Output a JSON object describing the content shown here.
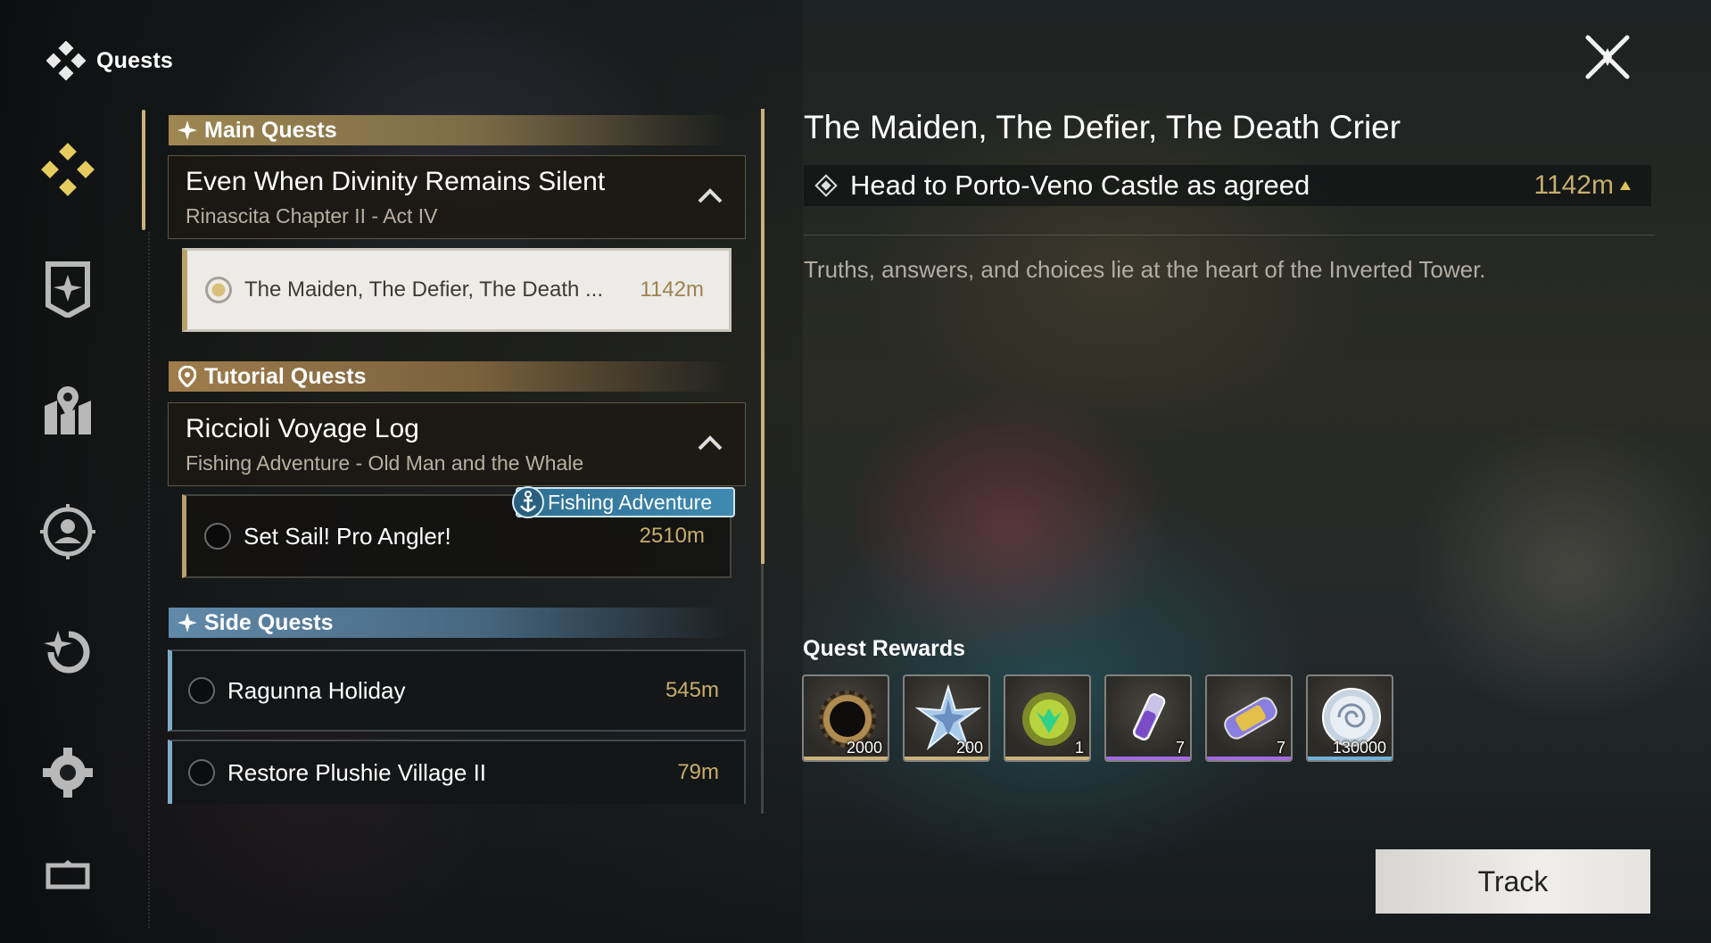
{
  "header": {
    "title": "Quests"
  },
  "nav": {
    "items": [
      {
        "name": "quests",
        "icon": "quest-diamond-icon",
        "active": true
      },
      {
        "name": "achievement",
        "icon": "shield-star-icon"
      },
      {
        "name": "map",
        "icon": "map-pin-icon"
      },
      {
        "name": "profile",
        "icon": "user-circle-icon"
      },
      {
        "name": "replay",
        "icon": "replay-star-icon"
      },
      {
        "name": "settings",
        "icon": "gear-icon"
      },
      {
        "name": "gallery",
        "icon": "gallery-icon"
      }
    ]
  },
  "sections": {
    "main": {
      "label": "Main Quests",
      "group_title": "Even When Divinity Remains Silent",
      "group_subtitle": "Rinascita Chapter II - Act IV",
      "quest": {
        "title": "The Maiden, The Defier, The Death ...",
        "distance": "1142m"
      }
    },
    "tutorial": {
      "label": "Tutorial Quests",
      "group_title": "Riccioli Voyage Log",
      "group_subtitle": "Fishing Adventure - Old Man and the Whale",
      "badge": "Fishing Adventure",
      "quest": {
        "title": "Set Sail! Pro Angler!",
        "distance": "2510m"
      }
    },
    "side": {
      "label": "Side Quests",
      "quests": [
        {
          "title": "Ragunna Holiday",
          "distance": "545m"
        },
        {
          "title": "Restore Plushie Village II",
          "distance": "79m"
        }
      ]
    }
  },
  "detail": {
    "title": "The Maiden, The Defier, The Death Crier",
    "objective": "Head to Porto-Veno Castle as agreed",
    "objective_distance": "1142m",
    "description": "Truths, answers, and choices lie at the heart of the Inverted Tower."
  },
  "rewards": {
    "title": "Quest Rewards",
    "items": [
      {
        "icon": "dark-ring-icon",
        "count": "2000",
        "rarity_color": "#c9b27a"
      },
      {
        "icon": "star-crystal-icon",
        "count": "200",
        "rarity_color": "#c9b27a"
      },
      {
        "icon": "green-orb-icon",
        "count": "1",
        "rarity_color": "#c9b27a"
      },
      {
        "icon": "purple-vial-icon",
        "count": "7",
        "rarity_color": "#a46be0"
      },
      {
        "icon": "capsule-icon",
        "count": "7",
        "rarity_color": "#a46be0"
      },
      {
        "icon": "shell-coin-icon",
        "count": "130000",
        "rarity_color": "#6fb4d8"
      }
    ]
  },
  "actions": {
    "track_label": "Track"
  },
  "colors": {
    "accent_gold": "#c9b27a",
    "side_blue": "#7eacc8",
    "distance": "#c8ad6c"
  }
}
